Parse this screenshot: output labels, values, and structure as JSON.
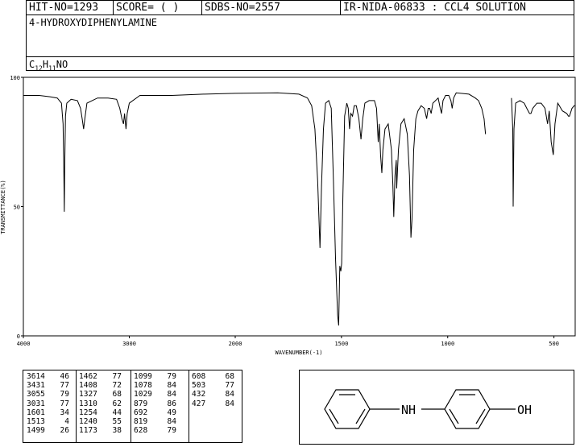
{
  "header": {
    "hit_no": "HIT-NO=1293",
    "score": "SCORE=  (  )",
    "sdbs_no": "SDBS-NO=2557",
    "spectrum_id": "IR-NIDA-06833 : CCL4 SOLUTION"
  },
  "compound": {
    "name": "4-HYDROXYDIPHENYLAMINE",
    "formula_c": "C",
    "formula_c_sub": "12",
    "formula_h": "H",
    "formula_h_sub": "11",
    "formula_rest": "NO"
  },
  "chart_data": {
    "type": "line",
    "xlabel": "WAVENUMBER(-1)",
    "ylabel": "TRANSMITTANCE(%)",
    "xlim": [
      4000,
      400
    ],
    "ylim": [
      0,
      100
    ],
    "x_ticks": [
      "4000",
      "3000",
      "2000",
      "1500",
      "1000",
      "500"
    ],
    "y_ticks": [
      "100",
      "50",
      "0"
    ],
    "segments": [
      [
        [
          4000,
          93
        ],
        [
          3850,
          93
        ],
        [
          3750,
          92.5
        ],
        [
          3680,
          92
        ],
        [
          3640,
          90
        ],
        [
          3625,
          82
        ],
        [
          3618,
          65
        ],
        [
          3614,
          48
        ],
        [
          3610,
          65
        ],
        [
          3602,
          85
        ],
        [
          3590,
          90
        ],
        [
          3550,
          91.5
        ],
        [
          3490,
          91
        ],
        [
          3460,
          88
        ],
        [
          3445,
          84
        ],
        [
          3431,
          80
        ],
        [
          3420,
          84
        ],
        [
          3400,
          90
        ],
        [
          3300,
          92
        ],
        [
          3200,
          92
        ],
        [
          3120,
          91.5
        ],
        [
          3090,
          88
        ],
        [
          3070,
          84
        ],
        [
          3055,
          82
        ],
        [
          3045,
          86
        ],
        [
          3031,
          80
        ],
        [
          3020,
          86
        ],
        [
          3000,
          90
        ],
        [
          2900,
          93
        ],
        [
          2600,
          93
        ],
        [
          2300,
          93.5
        ],
        [
          2000,
          93.8
        ],
        [
          1800,
          94
        ],
        [
          1700,
          93.5
        ],
        [
          1660,
          92
        ],
        [
          1640,
          89
        ],
        [
          1625,
          80
        ],
        [
          1612,
          60
        ],
        [
          1601,
          34
        ],
        [
          1594,
          58
        ],
        [
          1585,
          80
        ],
        [
          1575,
          90
        ],
        [
          1560,
          91
        ],
        [
          1548,
          88
        ],
        [
          1538,
          60
        ],
        [
          1528,
          30
        ],
        [
          1518,
          8
        ],
        [
          1513,
          4
        ],
        [
          1508,
          27
        ],
        [
          1503,
          25
        ],
        [
          1499,
          28
        ],
        [
          1493,
          55
        ],
        [
          1485,
          85
        ],
        [
          1475,
          90
        ],
        [
          1468,
          88
        ],
        [
          1462,
          80
        ],
        [
          1456,
          86
        ],
        [
          1448,
          85
        ],
        [
          1440,
          89
        ],
        [
          1430,
          89
        ],
        [
          1418,
          84
        ],
        [
          1408,
          76
        ],
        [
          1400,
          84
        ],
        [
          1390,
          90
        ],
        [
          1370,
          91
        ],
        [
          1345,
          91
        ],
        [
          1335,
          88
        ],
        [
          1327,
          75
        ],
        [
          1322,
          82
        ],
        [
          1316,
          70
        ],
        [
          1310,
          63
        ],
        [
          1305,
          72
        ],
        [
          1295,
          80
        ],
        [
          1280,
          82
        ],
        [
          1265,
          72
        ],
        [
          1258,
          58
        ],
        [
          1254,
          46
        ],
        [
          1248,
          62
        ],
        [
          1242,
          68
        ],
        [
          1240,
          57
        ],
        [
          1232,
          72
        ],
        [
          1220,
          82
        ],
        [
          1205,
          84
        ],
        [
          1190,
          78
        ],
        [
          1180,
          62
        ],
        [
          1173,
          38
        ],
        [
          1168,
          45
        ],
        [
          1160,
          72
        ],
        [
          1150,
          84
        ],
        [
          1140,
          87
        ],
        [
          1125,
          89
        ],
        [
          1110,
          88
        ],
        [
          1099,
          84
        ],
        [
          1092,
          88
        ],
        [
          1085,
          88
        ],
        [
          1078,
          86
        ],
        [
          1070,
          90
        ],
        [
          1045,
          92
        ],
        [
          1035,
          88
        ],
        [
          1029,
          86
        ],
        [
          1022,
          91
        ],
        [
          1010,
          93
        ],
        [
          995,
          93
        ],
        [
          985,
          91
        ],
        [
          979,
          88
        ],
        [
          972,
          92
        ],
        [
          960,
          94
        ],
        [
          900,
          93.5
        ],
        [
          870,
          92
        ],
        [
          855,
          91
        ],
        [
          840,
          88
        ],
        [
          829,
          84
        ],
        [
          822,
          78
        ]
      ],
      [
        [
          700,
          92
        ],
        [
          694,
          80
        ],
        [
          692,
          50
        ],
        [
          688,
          80
        ],
        [
          680,
          90
        ],
        [
          660,
          91
        ],
        [
          640,
          90
        ],
        [
          628,
          88
        ],
        [
          615,
          86
        ],
        [
          608,
          86
        ],
        [
          600,
          88
        ],
        [
          580,
          90
        ],
        [
          560,
          90
        ],
        [
          542,
          88
        ],
        [
          530,
          82
        ],
        [
          522,
          87
        ],
        [
          513,
          75
        ],
        [
          503,
          70
        ],
        [
          495,
          82
        ],
        [
          482,
          90
        ],
        [
          460,
          87
        ],
        [
          440,
          86
        ],
        [
          432,
          85
        ],
        [
          427,
          85
        ],
        [
          415,
          88
        ],
        [
          405,
          89
        ],
        [
          400,
          89
        ]
      ]
    ]
  },
  "peak_table": [
    [
      [
        "3614",
        "46"
      ],
      [
        "3431",
        "77"
      ],
      [
        "3055",
        "79"
      ],
      [
        "3031",
        "77"
      ],
      [
        "1601",
        "34"
      ],
      [
        "1513",
        "4"
      ],
      [
        "1499",
        "26"
      ]
    ],
    [
      [
        "1462",
        "77"
      ],
      [
        "1408",
        "72"
      ],
      [
        "1327",
        "68"
      ],
      [
        "1310",
        "62"
      ],
      [
        "1254",
        "44"
      ],
      [
        "1240",
        "55"
      ],
      [
        "1173",
        "38"
      ]
    ],
    [
      [
        "1099",
        "79"
      ],
      [
        "1078",
        "84"
      ],
      [
        "1029",
        "84"
      ],
      [
        "879",
        "86"
      ],
      [
        "692",
        "49"
      ],
      [
        "819",
        "84"
      ],
      [
        "628",
        "79"
      ]
    ],
    [
      [
        "608",
        "68"
      ],
      [
        "503",
        "77"
      ],
      [
        "432",
        "84"
      ],
      [
        "427",
        "84"
      ]
    ]
  ],
  "structure": {
    "nh_label": "NH",
    "oh_label": "OH"
  }
}
